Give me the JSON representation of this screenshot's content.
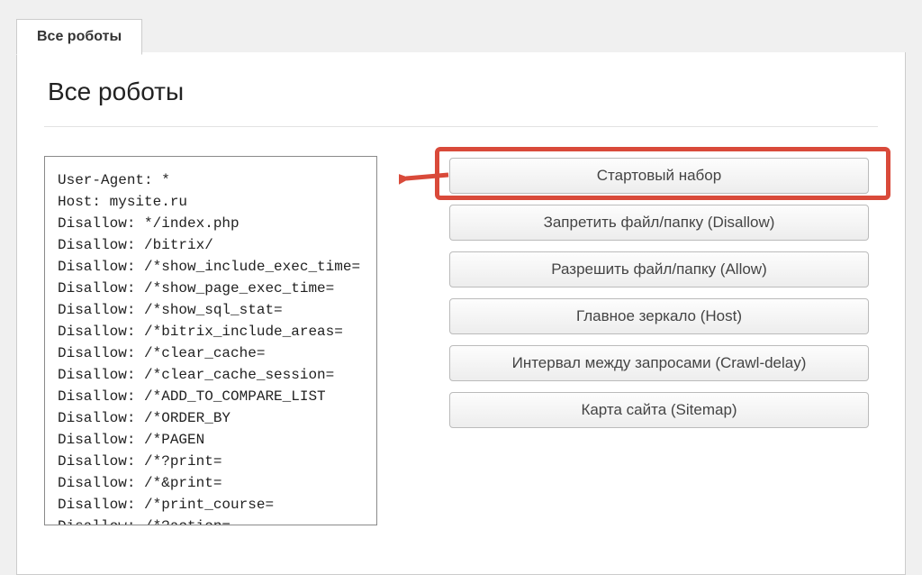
{
  "tab": {
    "label": "Все роботы"
  },
  "page": {
    "title": "Все роботы"
  },
  "robots_text": "User-Agent: *\nHost: mysite.ru\nDisallow: */index.php\nDisallow: /bitrix/\nDisallow: /*show_include_exec_time=\nDisallow: /*show_page_exec_time=\nDisallow: /*show_sql_stat=\nDisallow: /*bitrix_include_areas=\nDisallow: /*clear_cache=\nDisallow: /*clear_cache_session=\nDisallow: /*ADD_TO_COMPARE_LIST\nDisallow: /*ORDER_BY\nDisallow: /*PAGEN\nDisallow: /*?print=\nDisallow: /*&print=\nDisallow: /*print_course=\nDisallow: /*?action=",
  "buttons": {
    "starter": "Стартовый набор",
    "disallow": "Запретить файл/папку (Disallow)",
    "allow": "Разрешить файл/папку (Allow)",
    "host": "Главное зеркало (Host)",
    "crawl_delay": "Интервал между запросами (Crawl-delay)",
    "sitemap": "Карта сайта (Sitemap)"
  },
  "annotation": {
    "arrow_color": "#d94a3a"
  }
}
